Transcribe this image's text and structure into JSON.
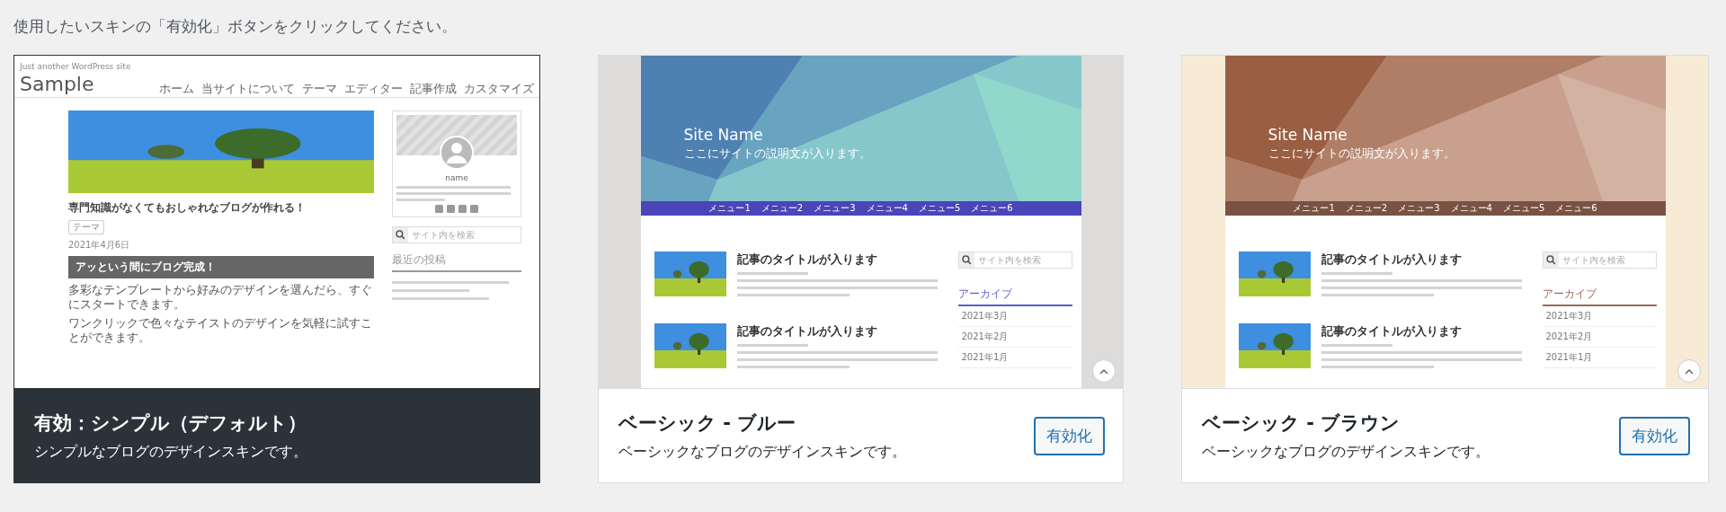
{
  "instruction": "使用したいスキンの「有効化」ボタンをクリックしてください。",
  "skins": [
    {
      "kind": "simple",
      "active": true,
      "title": "有効：シンプル（デフォルト）",
      "description": "シンプルなブログのデザインスキンです。",
      "preview": {
        "site_tagline": "Just another WordPress site",
        "site_title": "Sample",
        "menu": [
          "ホーム",
          "当サイトについて",
          "テーマ",
          "エディター",
          "記事作成",
          "カスタマイズ"
        ],
        "post_title": "専門知識がなくてもおしゃれなブログが作れる！",
        "tag": "テーマ",
        "date": "2021年4月6日",
        "banner": "アッという間にブログ完成！",
        "paragraphs": [
          "多彩なテンプレートから好みのデザインを選んだら、すぐにスタートできます。",
          "ワンクリックで色々なテイストのデザインを気軽に試すことができます。"
        ],
        "profile_name": "name",
        "search_placeholder": "サイト内を検索",
        "widget_title": "最近の投稿"
      }
    },
    {
      "kind": "basic-blue",
      "active": false,
      "title": "ベーシック - ブルー",
      "description": "ベーシックなブログのデザインスキンです。",
      "button": "有効化",
      "preview": {
        "site_name": "Site Name",
        "site_description": "ここにサイトの説明文が入ります。",
        "menu": [
          "メニュー1",
          "メニュー2",
          "メニュー3",
          "メニュー4",
          "メニュー5",
          "メニュー6"
        ],
        "posts": [
          {
            "title": "記事のタイトルが入ります"
          },
          {
            "title": "記事のタイトルが入ります"
          }
        ],
        "search_placeholder": "サイト内を検索",
        "archive_title": "アーカイブ",
        "archives": [
          "2021年3月",
          "2021年2月",
          "2021年1月"
        ]
      }
    },
    {
      "kind": "basic-brown",
      "active": false,
      "title": "ベーシック - ブラウン",
      "description": "ベーシックなブログのデザインスキンです。",
      "button": "有効化",
      "preview": {
        "site_name": "Site Name",
        "site_description": "ここにサイトの説明文が入ります。",
        "menu": [
          "メニュー1",
          "メニュー2",
          "メニュー3",
          "メニュー4",
          "メニュー5",
          "メニュー6"
        ],
        "posts": [
          {
            "title": "記事のタイトルが入ります"
          },
          {
            "title": "記事のタイトルが入ります"
          }
        ],
        "search_placeholder": "サイト内を検索",
        "archive_title": "アーカイブ",
        "archives": [
          "2021年3月",
          "2021年2月",
          "2021年1月"
        ]
      }
    }
  ]
}
